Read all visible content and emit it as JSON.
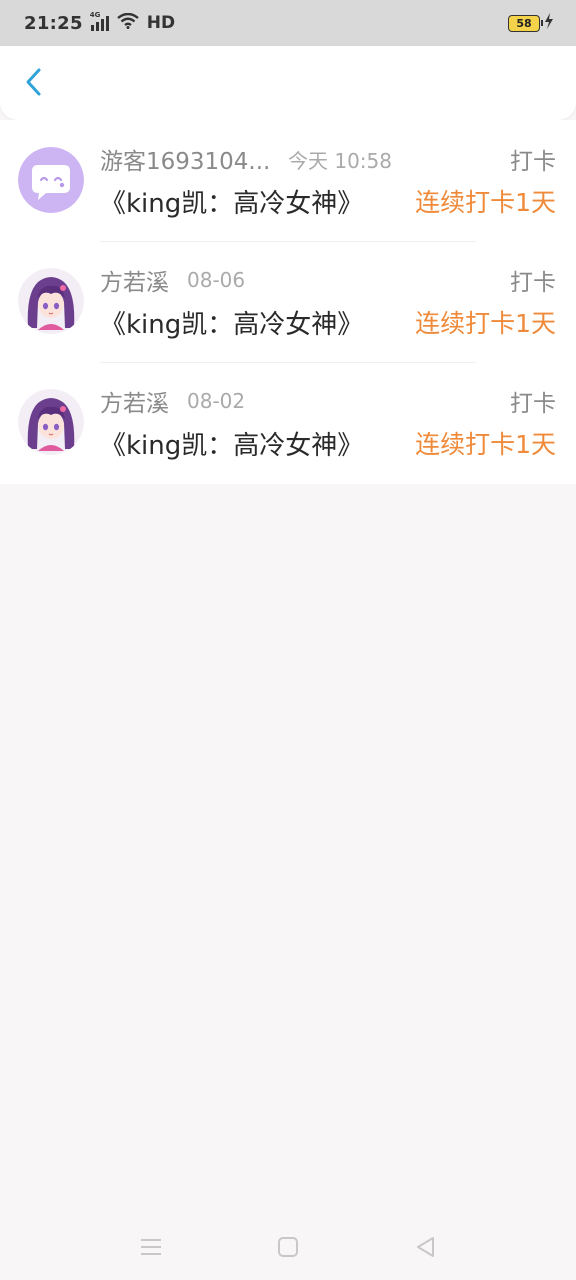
{
  "status_bar": {
    "time": "21:25",
    "network": "4G",
    "hd": "HD",
    "battery": "58"
  },
  "header": {
    "back_icon": "chevron-left-icon"
  },
  "items": [
    {
      "name": "游客1693104...",
      "time": "今天 10:58",
      "kind": "打卡",
      "book": "《king凯：高冷女神》",
      "streak": "连续打卡1天",
      "avatar": "chat-bubble-avatar"
    },
    {
      "name": "方若溪",
      "time": "08-06",
      "kind": "打卡",
      "book": "《king凯：高冷女神》",
      "streak": "连续打卡1天",
      "avatar": "anime-girl-avatar"
    },
    {
      "name": "方若溪",
      "time": "08-02",
      "kind": "打卡",
      "book": "《king凯：高冷女神》",
      "streak": "连续打卡1天",
      "avatar": "anime-girl-avatar"
    }
  ],
  "colors": {
    "accent_blue": "#2fa3d8",
    "streak_orange": "#ef8a3a",
    "avatar_purple": "#cdb4f3"
  },
  "nav": {
    "menu_icon": "menu-icon",
    "home_icon": "home-square-icon",
    "back_icon": "back-triangle-icon"
  }
}
